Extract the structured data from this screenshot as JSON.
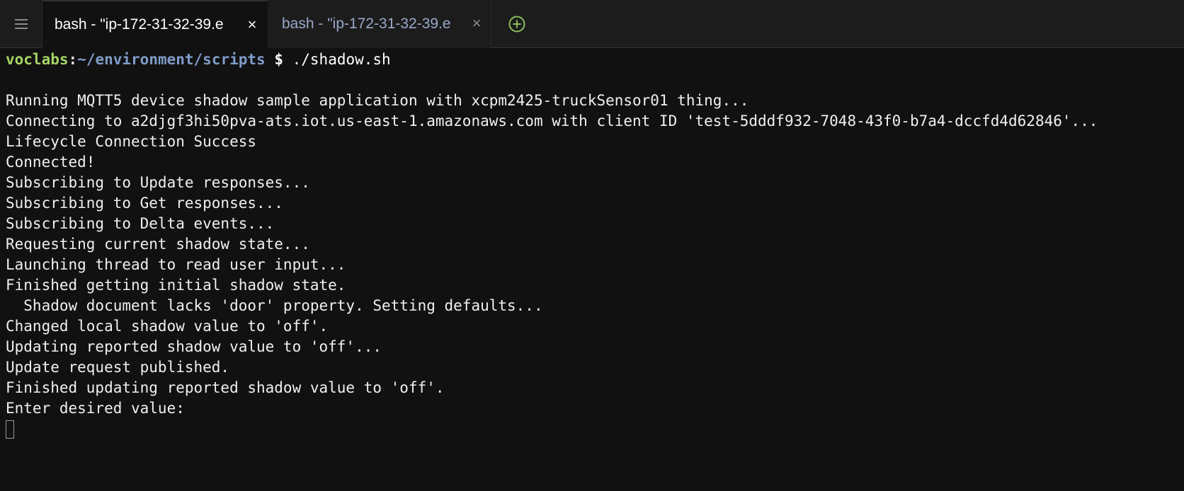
{
  "tabs": [
    {
      "label": "bash - \"ip-172-31-32-39.e",
      "close": "×",
      "active": true
    },
    {
      "label": "bash - \"ip-172-31-32-39.e",
      "close": "×",
      "active": false
    }
  ],
  "icons": {
    "menu": "hamburger-menu-icon",
    "add_tab": "plus-circle-icon"
  },
  "colors": {
    "prompt_user": "#a6d465",
    "prompt_path": "#7f9cc8",
    "add_tab": "#8cbe58"
  },
  "terminal": {
    "prompt": {
      "user": "voclabs",
      "colon": ":",
      "path": "~/environment/scripts",
      "dollar": " $ ",
      "command": "./shadow.sh"
    },
    "output": [
      "",
      "Running MQTT5 device shadow sample application with xcpm2425-truckSensor01 thing...",
      "Connecting to a2djgf3hi50pva-ats.iot.us-east-1.amazonaws.com with client ID 'test-5dddf932-7048-43f0-b7a4-dccfd4d62846'...",
      "Lifecycle Connection Success",
      "Connected!",
      "Subscribing to Update responses...",
      "Subscribing to Get responses...",
      "Subscribing to Delta events...",
      "Requesting current shadow state...",
      "Launching thread to read user input...",
      "Finished getting initial shadow state.",
      "  Shadow document lacks 'door' property. Setting defaults...",
      "Changed local shadow value to 'off'.",
      "Updating reported shadow value to 'off'...",
      "Update request published.",
      "Finished updating reported shadow value to 'off'.",
      "Enter desired value:"
    ]
  }
}
